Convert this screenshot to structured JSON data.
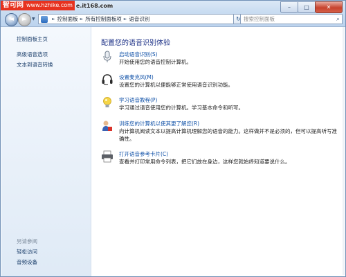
{
  "watermark": {
    "logo": "智可网",
    "url": "www.hzhike.com",
    "url2": "e.it168.com"
  },
  "window": {
    "controls": {
      "minimize": "–",
      "maximize": "□",
      "close": "✕"
    }
  },
  "nav": {
    "back_icon": "back-arrow-icon",
    "breadcrumbs": [
      "控制面板",
      "所有控制面板项",
      "语音识别"
    ],
    "refresh_glyph": "↻",
    "search_placeholder": "搜索控制面板",
    "search_glyph": "⌕"
  },
  "sidebar": {
    "home": "控制面板主页",
    "links": [
      "高级语音选项",
      "文本到语音转换"
    ],
    "see_also_label": "另请参阅",
    "see_also": [
      "轻松访问",
      "音频设备"
    ]
  },
  "main": {
    "title": "配置您的语音识别体验",
    "items": [
      {
        "icon": "microphone-icon",
        "link": "启动语音识别(S)",
        "desc": "开始使用您的语音控制计算机。"
      },
      {
        "icon": "headset-icon",
        "link": "设置麦克风(M)",
        "desc": "设置您的计算机以便能够正常使用语音识别功能。"
      },
      {
        "icon": "lightbulb-icon",
        "link": "学习语音教程(P)",
        "desc": "学习通过语音使用您的计算机。学习基本命令和听写。"
      },
      {
        "icon": "user-train-icon",
        "link": "训练您的计算机以使其更了解您(R)",
        "desc": "向计算机阅读文本以提高计算机理解您的语音的能力。这样做并不是必须的，但可以提高听写准确性。"
      },
      {
        "icon": "printer-icon",
        "link": "打开语音参考卡片(C)",
        "desc": "查看并打印常用命令列表，把它们放在身边，这样您就始终知道要说什么。"
      }
    ]
  },
  "colors": {
    "link": "#1152a8",
    "heading": "#1e3287",
    "sidebar_link": "#1c3f6b",
    "watermark": "#e7321f"
  }
}
